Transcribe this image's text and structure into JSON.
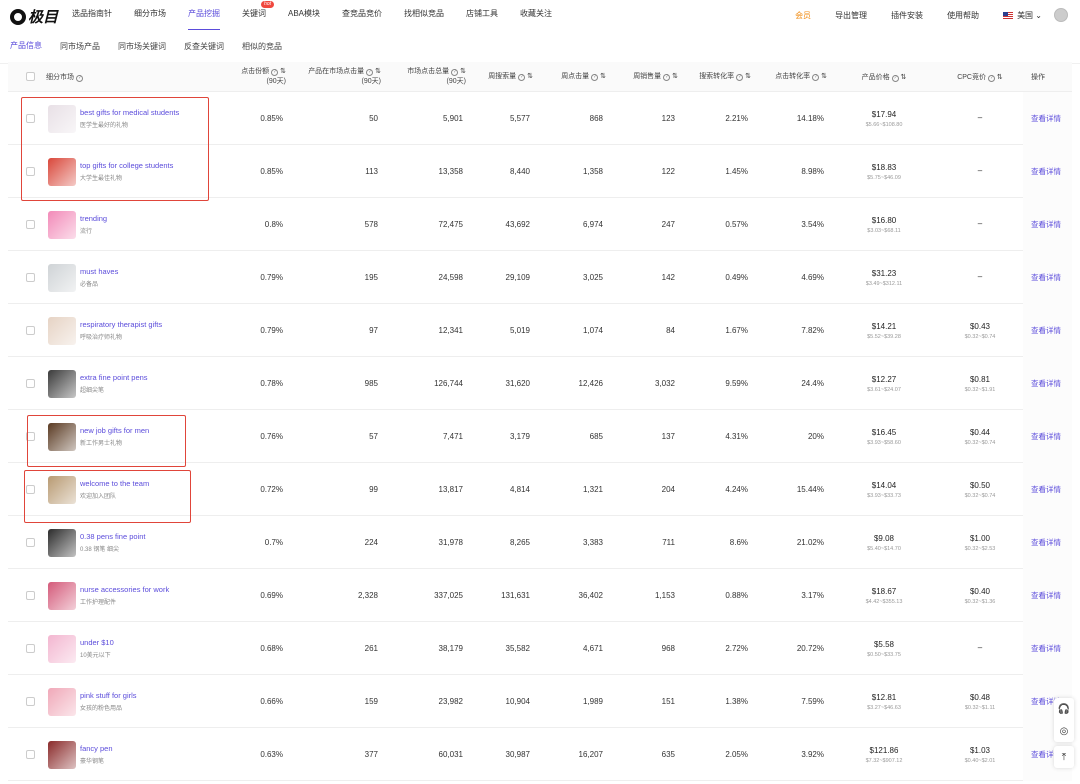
{
  "nav": {
    "logo": "极目",
    "items": [
      "选品指南针",
      "细分市场",
      "产品挖掘",
      "关键词",
      "ABA模块",
      "查竞品竞价",
      "找相似竞品",
      "店铺工具",
      "收藏关注"
    ],
    "hot_badge": "hot",
    "right": [
      "会员",
      "导出管理",
      "插件安装",
      "使用帮助"
    ],
    "country": "美国"
  },
  "subtabs": [
    "产品信息",
    "同市场产品",
    "同市场关键词",
    "反查关键词",
    "相似的竞品"
  ],
  "headers": {
    "market": "细分市场",
    "click_share": "点击份额",
    "click_share_sub": "(90天)",
    "product_clicks": "产品在市场点击量",
    "product_clicks_sub": "(90天)",
    "market_clicks": "市场点击总量",
    "market_clicks_sub": "(90天)",
    "weekly_search": "周搜索量",
    "weekly_clicks": "周点击量",
    "weekly_sales": "周销售量",
    "search_cvr": "搜索转化率",
    "click_cvr": "点击转化率",
    "price": "产品价格",
    "cpc": "CPC竞价",
    "action": "操作"
  },
  "action_label": "查看详情",
  "rows": [
    {
      "name": "best gifts for medical students",
      "cn": "医学生最好的礼物",
      "share": "0.85%",
      "pclicks": "50",
      "mclicks": "5,901",
      "wsearch": "5,577",
      "wclicks": "868",
      "wsales": "123",
      "scvr": "2.21%",
      "ccvr": "14.18%",
      "price": "$17.94",
      "prange": "$5.66~$108.80",
      "cpc": "–",
      "crange": "",
      "color": "#e8e0e6"
    },
    {
      "name": "top gifts for college students",
      "cn": "大学生最佳礼物",
      "share": "0.85%",
      "pclicks": "113",
      "mclicks": "13,358",
      "wsearch": "8,440",
      "wclicks": "1,358",
      "wsales": "122",
      "scvr": "1.45%",
      "ccvr": "8.98%",
      "price": "$18.83",
      "prange": "$5.75~$46.09",
      "cpc": "–",
      "crange": "",
      "color": "#d9473a"
    },
    {
      "name": "trending",
      "cn": "流行",
      "share": "0.8%",
      "pclicks": "578",
      "mclicks": "72,475",
      "wsearch": "43,692",
      "wclicks": "6,974",
      "wsales": "247",
      "scvr": "0.57%",
      "ccvr": "3.54%",
      "price": "$16.80",
      "prange": "$3.03~$68.11",
      "cpc": "–",
      "crange": "",
      "color": "#f28ab8"
    },
    {
      "name": "must haves",
      "cn": "必备品",
      "share": "0.79%",
      "pclicks": "195",
      "mclicks": "24,598",
      "wsearch": "29,109",
      "wclicks": "3,025",
      "wsales": "142",
      "scvr": "0.49%",
      "ccvr": "4.69%",
      "price": "$31.23",
      "prange": "$3.49~$312.11",
      "cpc": "–",
      "crange": "",
      "color": "#cfd3d6"
    },
    {
      "name": "respiratory therapist gifts",
      "cn": "呼吸治疗师礼物",
      "share": "0.79%",
      "pclicks": "97",
      "mclicks": "12,341",
      "wsearch": "5,019",
      "wclicks": "1,074",
      "wsales": "84",
      "scvr": "1.67%",
      "ccvr": "7.82%",
      "price": "$14.21",
      "prange": "$5.52~$39.28",
      "cpc": "$0.43",
      "crange": "$0.32~$0.74",
      "color": "#e6d3c4"
    },
    {
      "name": "extra fine point pens",
      "cn": "超细尖笔",
      "share": "0.78%",
      "pclicks": "985",
      "mclicks": "126,744",
      "wsearch": "31,620",
      "wclicks": "12,426",
      "wsales": "3,032",
      "scvr": "9.59%",
      "ccvr": "24.4%",
      "price": "$12.27",
      "prange": "$3.61~$24.07",
      "cpc": "$0.81",
      "crange": "$0.32~$1.91",
      "color": "#3a3a3a"
    },
    {
      "name": "new job gifts for men",
      "cn": "新工作男士礼物",
      "share": "0.76%",
      "pclicks": "57",
      "mclicks": "7,471",
      "wsearch": "3,179",
      "wclicks": "685",
      "wsales": "137",
      "scvr": "4.31%",
      "ccvr": "20%",
      "price": "$16.45",
      "prange": "$3.93~$58.60",
      "cpc": "$0.44",
      "crange": "$0.32~$0.74",
      "color": "#5a3a22"
    },
    {
      "name": "welcome to the team",
      "cn": "欢迎加入团队",
      "share": "0.72%",
      "pclicks": "99",
      "mclicks": "13,817",
      "wsearch": "4,814",
      "wclicks": "1,321",
      "wsales": "204",
      "scvr": "4.24%",
      "ccvr": "15.44%",
      "price": "$14.04",
      "prange": "$3.93~$33.73",
      "cpc": "$0.50",
      "crange": "$0.32~$0.74",
      "color": "#b89a72"
    },
    {
      "name": "0.38 pens fine point",
      "cn": "0.38 钢笔 细尖",
      "share": "0.7%",
      "pclicks": "224",
      "mclicks": "31,978",
      "wsearch": "8,265",
      "wclicks": "3,383",
      "wsales": "711",
      "scvr": "8.6%",
      "ccvr": "21.02%",
      "price": "$9.08",
      "prange": "$5.40~$14.70",
      "cpc": "$1.00",
      "crange": "$0.32~$2.53",
      "color": "#2b2b2b"
    },
    {
      "name": "nurse accessories for work",
      "cn": "工作护理配件",
      "share": "0.69%",
      "pclicks": "2,328",
      "mclicks": "337,025",
      "wsearch": "131,631",
      "wclicks": "36,402",
      "wsales": "1,153",
      "scvr": "0.88%",
      "ccvr": "3.17%",
      "price": "$18.67",
      "prange": "$4.42~$355.13",
      "cpc": "$0.40",
      "crange": "$0.32~$1.36",
      "color": "#d45a7a"
    },
    {
      "name": "under $10",
      "cn": "10美元以下",
      "share": "0.68%",
      "pclicks": "261",
      "mclicks": "38,179",
      "wsearch": "35,582",
      "wclicks": "4,671",
      "wsales": "968",
      "scvr": "2.72%",
      "ccvr": "20.72%",
      "price": "$5.58",
      "prange": "$0.50~$33.75",
      "cpc": "–",
      "crange": "",
      "color": "#f3b6d0"
    },
    {
      "name": "pink stuff for girls",
      "cn": "女孩的粉色用品",
      "share": "0.66%",
      "pclicks": "159",
      "mclicks": "23,982",
      "wsearch": "10,904",
      "wclicks": "1,989",
      "wsales": "151",
      "scvr": "1.38%",
      "ccvr": "7.59%",
      "price": "$12.81",
      "prange": "$3.27~$46.63",
      "cpc": "$0.48",
      "crange": "$0.32~$1.11",
      "color": "#f0a8b8"
    },
    {
      "name": "fancy pen",
      "cn": "豪华钢笔",
      "share": "0.63%",
      "pclicks": "377",
      "mclicks": "60,031",
      "wsearch": "30,987",
      "wclicks": "16,207",
      "wsales": "635",
      "scvr": "2.05%",
      "ccvr": "3.92%",
      "price": "$121.86",
      "prange": "$7.32~$907.12",
      "cpc": "$1.03",
      "crange": "$0.40~$2.01",
      "color": "#8a2a2a"
    }
  ],
  "colors": {
    "accent": "#5b4cdb",
    "highlight": "#e0453a",
    "vip": "#f08b12"
  }
}
